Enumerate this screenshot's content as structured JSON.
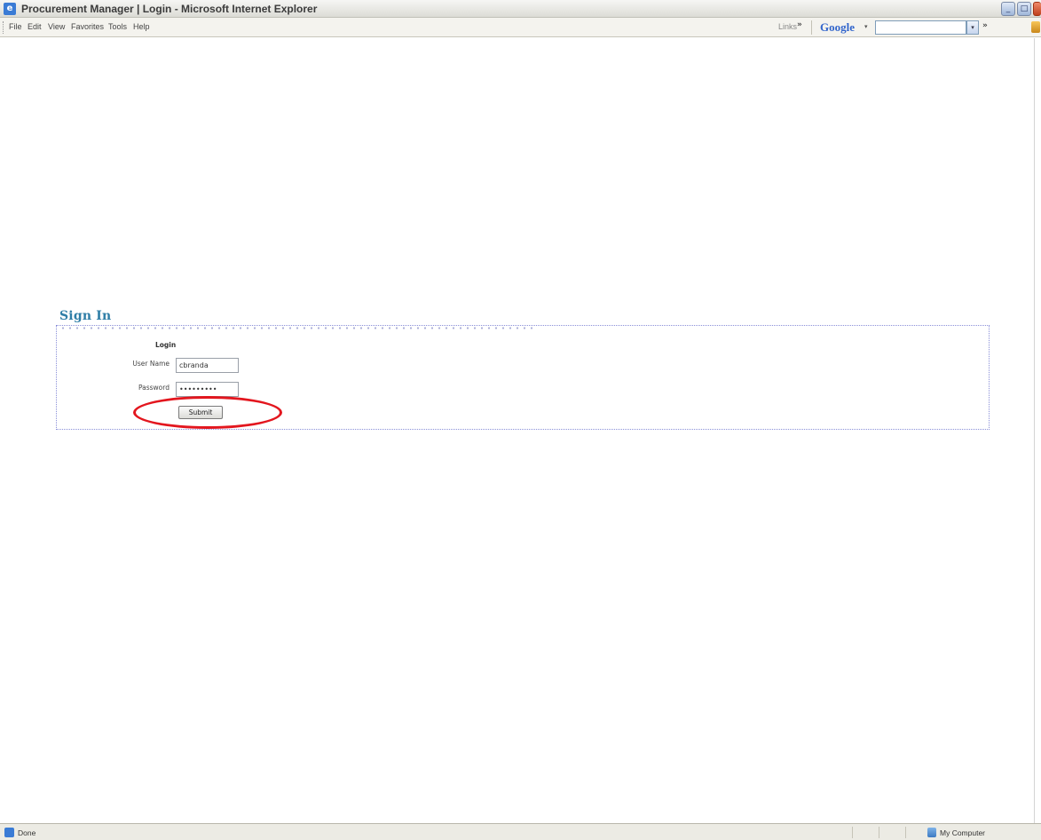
{
  "window": {
    "title": "Procurement Manager | Login - Microsoft Internet Explorer",
    "controls": {
      "minimize": "_",
      "maximize": "□",
      "close": "x"
    }
  },
  "menu": {
    "items": [
      "File",
      "Edit",
      "View",
      "Favorites",
      "Tools",
      "Help"
    ]
  },
  "toolbar": {
    "links_label": "Links",
    "links_chevron": "»",
    "google_label": "Google",
    "google_dropdown_arrow": "▾",
    "search_value": "",
    "search_dropdown_arrow": "▾",
    "more_chevron": "»"
  },
  "page": {
    "section_title": "Sign In",
    "form_heading": "Login",
    "username_label": "User Name",
    "username_value": "cbranda",
    "password_label": "Password",
    "password_value": "•••••••••",
    "submit_label": "Submit"
  },
  "annotation": {
    "color": "#e3161e"
  },
  "statusbar": {
    "status_text": "Done",
    "zone_text": "My Computer"
  },
  "colors": {
    "section_title": "#2f7ea7",
    "box_border": "#8a8fd8",
    "google_blue": "#3366cc"
  }
}
